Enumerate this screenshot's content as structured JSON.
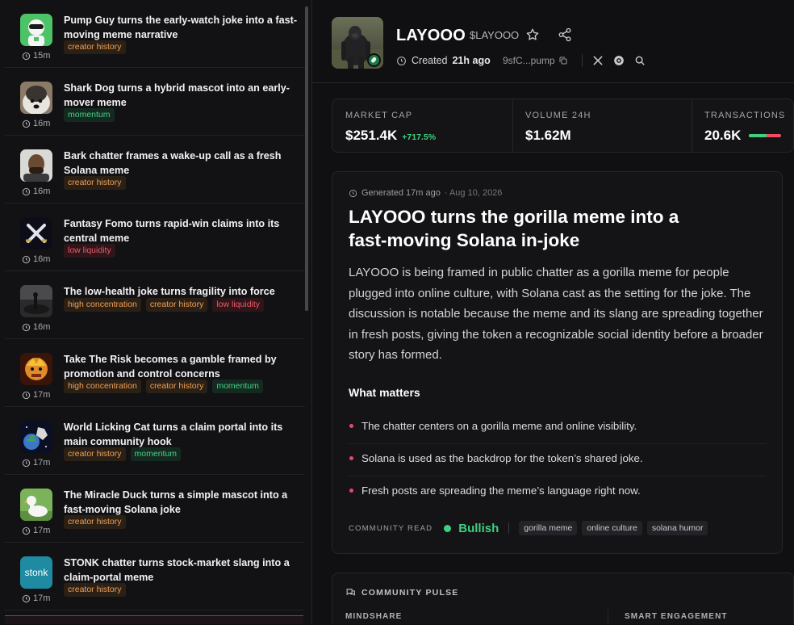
{
  "feed": {
    "items": [
      {
        "title": "Pump Guy turns the early-watch joke into a fast-moving meme narrative",
        "time": "15m",
        "tags": [
          {
            "label": "creator history",
            "kind": "creator"
          }
        ],
        "thumb": "pump-guy"
      },
      {
        "title": "Shark Dog turns a hybrid mascot into an early-mover meme",
        "time": "16m",
        "tags": [
          {
            "label": "momentum",
            "kind": "momentum"
          }
        ],
        "thumb": "shark-dog"
      },
      {
        "title": "Bark chatter frames a wake-up call as a fresh Solana meme",
        "time": "16m",
        "tags": [
          {
            "label": "creator history",
            "kind": "creator"
          }
        ],
        "thumb": "bark"
      },
      {
        "title": "Fantasy Fomo turns rapid-win claims into its central meme",
        "time": "16m",
        "tags": [
          {
            "label": "low liquidity",
            "kind": "liquidity"
          }
        ],
        "thumb": "fantasy-fomo"
      },
      {
        "title": "The low-health joke turns fragility into force",
        "time": "16m",
        "tags": [
          {
            "label": "high concentration",
            "kind": "concentration"
          },
          {
            "label": "creator history",
            "kind": "creator"
          },
          {
            "label": "low liquidity",
            "kind": "liquidity"
          }
        ],
        "thumb": "low-health"
      },
      {
        "title": "Take The Risk becomes a gamble framed by promotion and control concerns",
        "time": "17m",
        "tags": [
          {
            "label": "high concentration",
            "kind": "concentration"
          },
          {
            "label": "creator history",
            "kind": "creator"
          },
          {
            "label": "momentum",
            "kind": "momentum"
          }
        ],
        "thumb": "take-risk"
      },
      {
        "title": "World Licking Cat turns a claim portal into its main community hook",
        "time": "17m",
        "tags": [
          {
            "label": "creator history",
            "kind": "creator"
          },
          {
            "label": "momentum",
            "kind": "momentum"
          }
        ],
        "thumb": "cat"
      },
      {
        "title": "The Miracle Duck turns a simple mascot into a fast-moving Solana joke",
        "time": "17m",
        "tags": [
          {
            "label": "creator history",
            "kind": "creator"
          }
        ],
        "thumb": "duck"
      },
      {
        "title": "STONK chatter turns stock-market slang into a claim-portal meme",
        "time": "17m",
        "tags": [
          {
            "label": "creator history",
            "kind": "creator"
          }
        ],
        "thumb": "stonk",
        "thumb_text": "stonk"
      }
    ]
  },
  "token": {
    "name": "LAYOOO",
    "ticker": "$LAYOOO",
    "created_label": "Created",
    "created_ago": "21h ago",
    "contract": "9sfC...pump"
  },
  "stats": {
    "market_cap": {
      "label": "MARKET CAP",
      "value": "$251.4K",
      "change": "+717.5%"
    },
    "volume": {
      "label": "VOLUME 24H",
      "value": "$1.62M"
    },
    "transactions": {
      "label": "TRANSACTIONS",
      "value": "20.6K",
      "buy_fraction": 0.55
    }
  },
  "analysis": {
    "generated": "Generated 17m ago",
    "date": "· Aug 10, 2026",
    "headline": "LAYOOO turns the gorilla meme into a fast-moving Solana in-joke",
    "summary": "LAYOOO is being framed in public chatter as a gorilla meme for people plugged into online culture, with Solana cast as the setting for the joke. The discussion is notable because the meme and its slang are spreading together in fresh posts, giving the token a recognizable social identity before a broader story has formed.",
    "what_matters_title": "What matters",
    "points": [
      "The chatter centers on a gorilla meme and online visibility.",
      "Solana is used as the backdrop for the token’s shared joke.",
      "Fresh posts are spreading the meme’s language right now."
    ],
    "community_label": "COMMUNITY READ",
    "sentiment": "Bullish",
    "chips": [
      "gorilla meme",
      "online culture",
      "solana humor"
    ]
  },
  "pulse": {
    "title": "COMMUNITY PULSE",
    "mindshare": "MINDSHARE",
    "smart": "SMART ENGAGEMENT"
  },
  "colors": {
    "accent_green": "#3fcf7f",
    "accent_red": "#ef4d63",
    "tag_orange": "#f0a055"
  }
}
